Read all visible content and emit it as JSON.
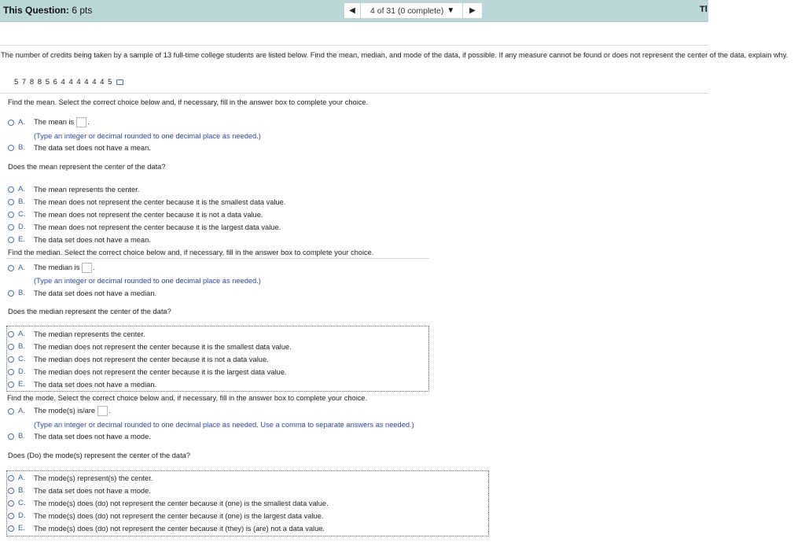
{
  "header": {
    "question_label": "This Question:",
    "question_points": "6 pts",
    "progress": "4 of 31 (0 complete)",
    "cut_text": "Tl"
  },
  "prompt": {
    "text": "The number of credits being taken by a sample of 13 full-time college students are listed below. Find the mean, median, and mode of the data, if possible. If any measure cannot be found or does not represent the center of the data, explain why.",
    "dataset": "5 7 8 8 5 6 4 4 4 4 4 4 5"
  },
  "mean_part": {
    "instruction": "Find the mean. Select the correct choice below and, if necessary, fill in the answer box to complete your choice.",
    "options": [
      {
        "letter": "A.",
        "text": "The mean is"
      },
      {
        "letter": "B.",
        "text": "The data set does not have a mean."
      }
    ],
    "hint": "(Type an integer or decimal rounded to one decimal place as needed.)"
  },
  "mean_center": {
    "question": "Does the mean represent the center of the data?",
    "options": [
      {
        "letter": "A.",
        "text": "The mean represents the center."
      },
      {
        "letter": "B.",
        "text": "The mean does not represent the center because it is the smallest data value."
      },
      {
        "letter": "C.",
        "text": "The mean does not represent the center because it is not a data value."
      },
      {
        "letter": "D.",
        "text": "The mean does not represent the center because it is the largest data value."
      },
      {
        "letter": "E.",
        "text": "The data set does not have a mean."
      }
    ]
  },
  "median_part": {
    "instruction": "Find the median. Select the correct choice below and, if necessary, fill in the answer box to complete your choice.",
    "options": [
      {
        "letter": "A.",
        "text": "The median is"
      },
      {
        "letter": "B.",
        "text": "The data set does not have a median."
      }
    ],
    "hint": "(Type an integer or decimal rounded to one decimal place as needed.)"
  },
  "median_center": {
    "question": "Does the median represent the center of the data?",
    "options": [
      {
        "letter": "A.",
        "text": "The median represents the center."
      },
      {
        "letter": "B.",
        "text": "The median does not represent the center because it is the smallest data value."
      },
      {
        "letter": "C.",
        "text": "The median does not represent the center because it is not a data value."
      },
      {
        "letter": "D.",
        "text": "The median does not represent the center because it is the largest data value."
      },
      {
        "letter": "E.",
        "text": "The data set does not have a median."
      }
    ]
  },
  "mode_part": {
    "instruction": "Find the mode. Select the correct choice below and, if necessary, fill in the answer box to complete your choice.",
    "options": [
      {
        "letter": "A.",
        "text": "The mode(s) is/are"
      },
      {
        "letter": "B.",
        "text": "The data set does not have a mode."
      }
    ],
    "hint": "(Type an integer or decimal rounded to one decimal place as needed. Use a comma to separate answers as needed.)"
  },
  "mode_center": {
    "question": "Does (Do) the mode(s) represent the center of the data?",
    "options": [
      {
        "letter": "A.",
        "text": "The mode(s) represent(s) the center."
      },
      {
        "letter": "B.",
        "text": "The data set does not have a mode."
      },
      {
        "letter": "C.",
        "text": "The mode(s) does (do) not represent the center because it (one) is the smallest data value."
      },
      {
        "letter": "D.",
        "text": "The mode(s) does (do) not represent the center because it (one) is the largest data value."
      },
      {
        "letter": "E.",
        "text": "The mode(s) does (do) not represent the center because it (they) is (are) not a data value."
      }
    ]
  },
  "punct": {
    "period": "."
  },
  "icons": {
    "prev": "triangle-left",
    "next": "triangle-right",
    "dropdown": "triangle-down",
    "copy": "copy-data"
  }
}
